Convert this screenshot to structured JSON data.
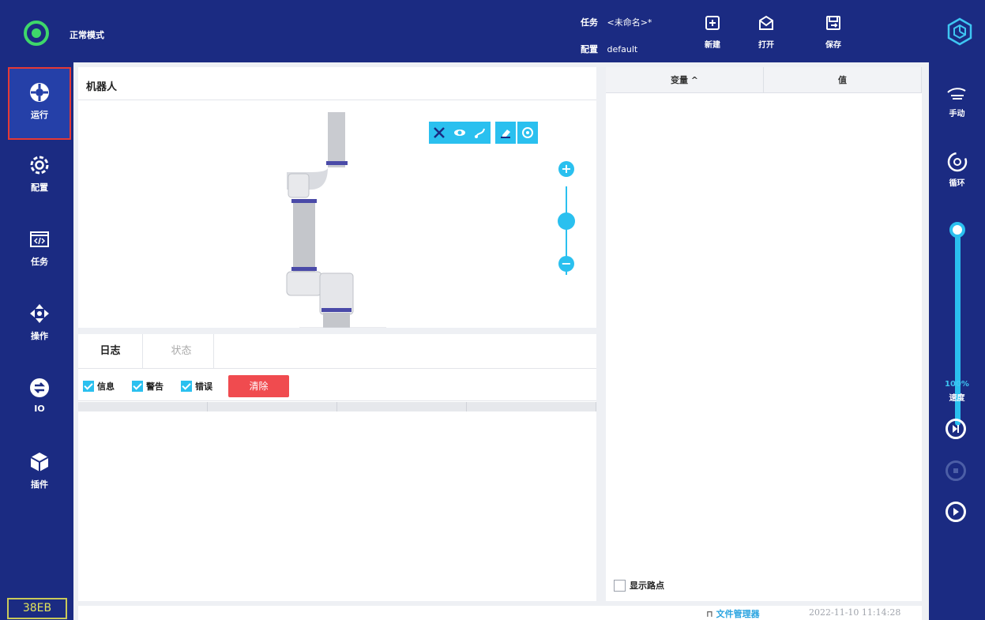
{
  "topbar": {
    "mode": "正常模式",
    "task_key": "任务",
    "task_value": "<未命名>*",
    "config_key": "配置",
    "config_value": "default",
    "new_label": "新建",
    "open_label": "打开",
    "save_label": "保存",
    "status_color": "#3ed86a"
  },
  "sidebar": {
    "items": [
      {
        "label": "运行",
        "icon": "run-icon"
      },
      {
        "label": "配置",
        "icon": "gear-icon"
      },
      {
        "label": "任务",
        "icon": "code-icon"
      },
      {
        "label": "操作",
        "icon": "move-icon"
      },
      {
        "label": "IO",
        "icon": "io-icon"
      },
      {
        "label": "插件",
        "icon": "plugin-icon"
      }
    ],
    "device_id": "38EB"
  },
  "robot": {
    "title": "机器人",
    "tools": [
      "tool-icon",
      "eye-icon",
      "path-icon",
      "eraser-icon",
      "rotate-icon"
    ]
  },
  "log": {
    "tabs": [
      "日志",
      "状态"
    ],
    "filters": [
      "信息",
      "警告",
      "错误"
    ],
    "clear_label": "清除"
  },
  "variables": {
    "col_name": "变量 ^",
    "col_value": "值",
    "show_points_label": "显示路点"
  },
  "right": {
    "manual_label": "手动",
    "loop_label": "循环",
    "speed_pct": "100%",
    "speed_label": "速度",
    "speed_value": 1.0
  },
  "footer": {
    "file_manager": "文件管理器",
    "timestamp": "2022-11-10 11:14:28"
  },
  "colors": {
    "accent": "#2ac0ef",
    "danger": "#f04b4f",
    "nav_bg": "#1b2b82"
  }
}
